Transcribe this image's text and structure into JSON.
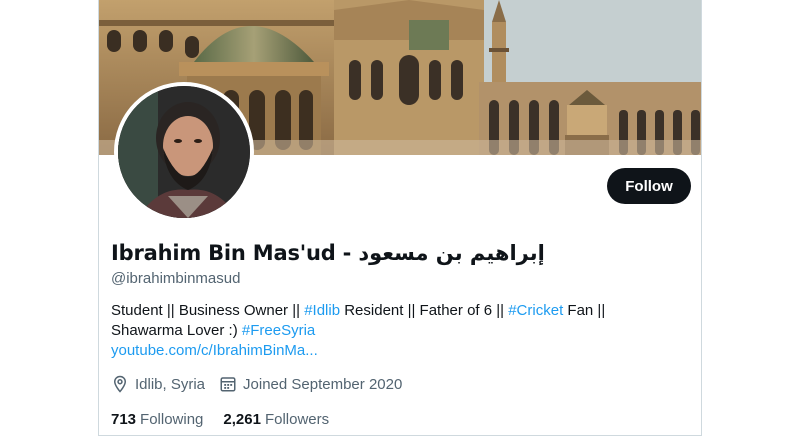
{
  "profile": {
    "name_latin": "Ibrahim Bin Mas'ud - ",
    "name_arabic": "إبراهيم بن مسعود",
    "handle": "@ibrahimbinmasud",
    "follow_label": "Follow"
  },
  "bio": {
    "p1": "Student || Business Owner || ",
    "tag_idlib": "#Idlib",
    "p2": " Resident || Father of 6 || ",
    "tag_cricket": "#Cricket",
    "p3": " Fan ||",
    "p4": "Shawarma Lover :) ",
    "tag_freesyria": "#FreeSyria",
    "link": "youtube.com/c/IbrahimBinMa..."
  },
  "meta": {
    "location": "Idlib, Syria",
    "joined": "Joined September 2020",
    "location_icon": "location-pin-icon",
    "calendar_icon": "calendar-icon"
  },
  "counts": {
    "following_num": "713",
    "following_label": "Following",
    "followers_num": "2,261",
    "followers_label": "Followers"
  },
  "colors": {
    "link": "#1d9bf0",
    "secondary_text": "#536471",
    "primary_text": "#0f1419",
    "button_bg": "#0f1419"
  }
}
